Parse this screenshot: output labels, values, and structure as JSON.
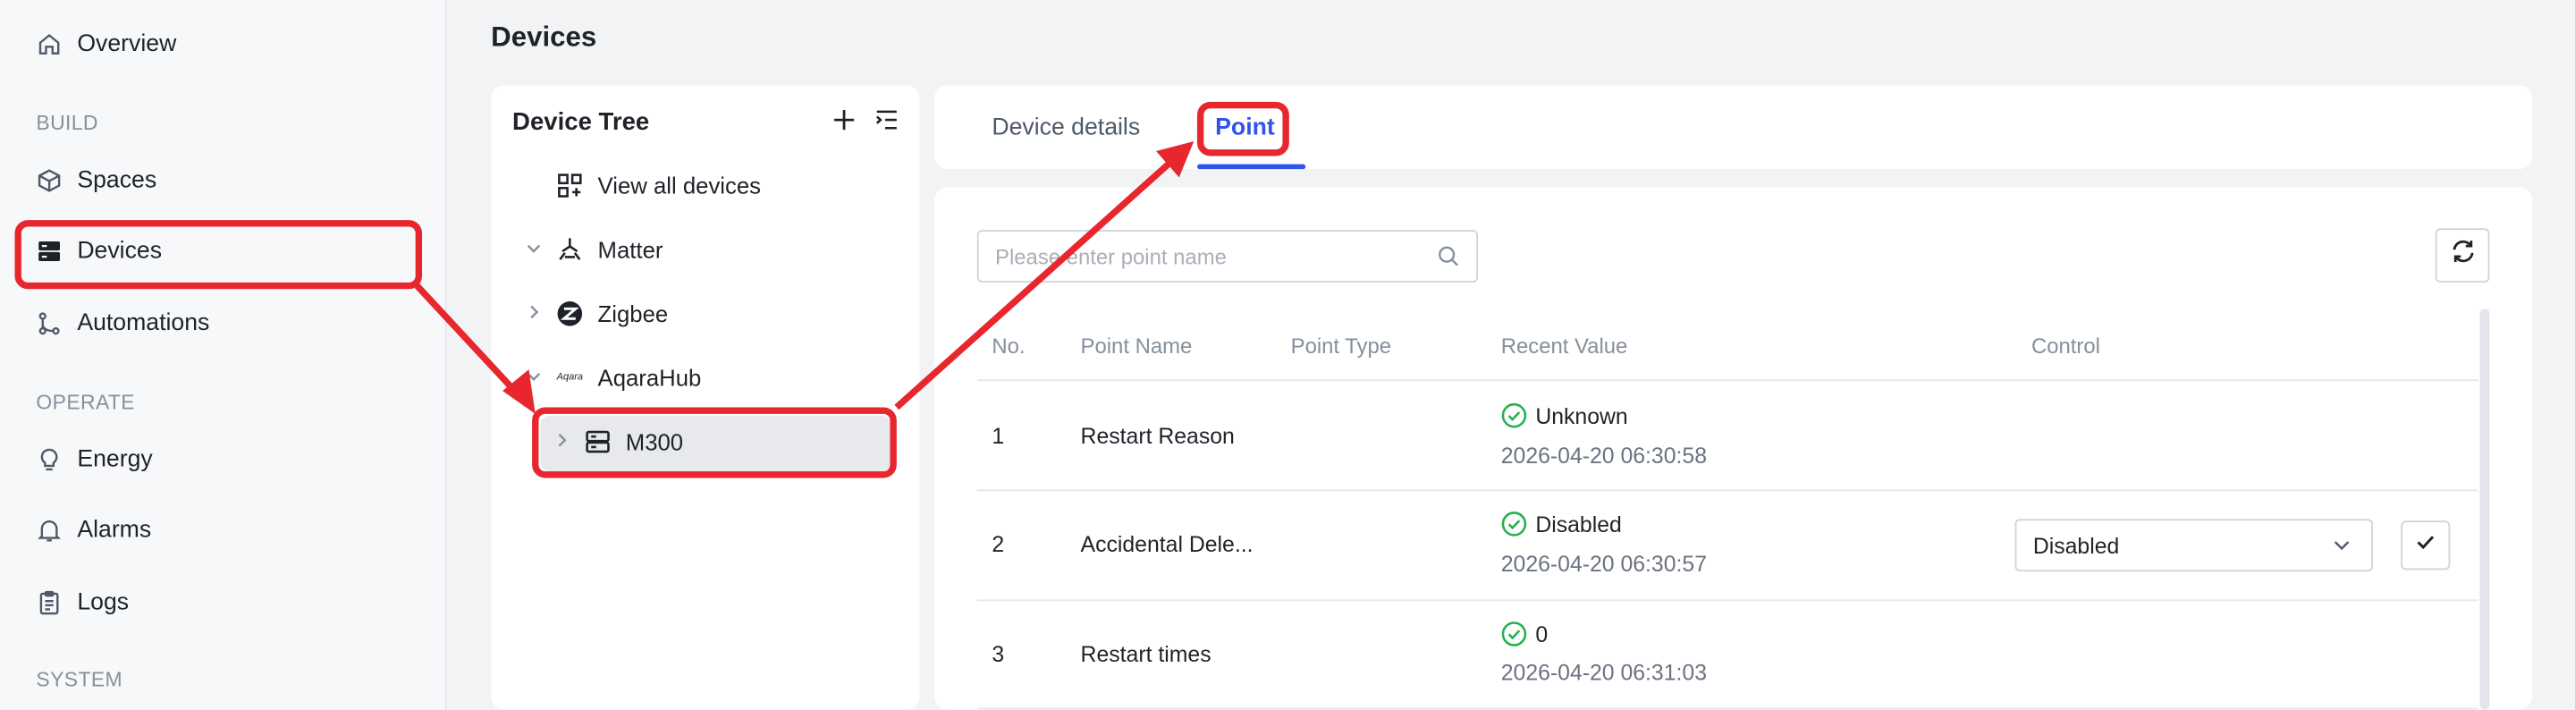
{
  "sidebar": {
    "overview": "Overview",
    "section_build": "BUILD",
    "spaces": "Spaces",
    "devices": "Devices",
    "automations": "Automations",
    "section_operate": "OPERATE",
    "energy": "Energy",
    "alarms": "Alarms",
    "logs": "Logs",
    "section_system": "SYSTEM"
  },
  "page_title": "Devices",
  "tree": {
    "title": "Device Tree",
    "view_all": "View all devices",
    "nodes": [
      "Matter",
      "Zigbee",
      "AqaraHub",
      "M300"
    ],
    "aqara_logo_text": "Aqara"
  },
  "tabs": [
    "Device details",
    "Point"
  ],
  "search": {
    "placeholder": "Please enter point name",
    "value": ""
  },
  "table": {
    "headers": [
      "No.",
      "Point Name",
      "Point Type",
      "Recent Value",
      "Control"
    ],
    "rows": [
      {
        "no": "1",
        "name": "Restart Reason",
        "type": "",
        "value": "Unknown",
        "time": "2026-04-20 06:30:58"
      },
      {
        "no": "2",
        "name": "Accidental Dele...",
        "type": "",
        "value": "Disabled",
        "time": "2026-04-20 06:30:57",
        "control_value": "Disabled"
      },
      {
        "no": "3",
        "name": "Restart times",
        "type": "",
        "value": "0",
        "time": "2026-04-20 06:31:03"
      }
    ]
  },
  "colors": {
    "accent": "#2f54eb",
    "status_ok": "#23b14d",
    "annotation": "#e8262d"
  },
  "icons": [
    "home-icon",
    "cube-icon",
    "server-icon",
    "branch-icon",
    "bulb-icon",
    "bell-icon",
    "clipboard-icon",
    "plus-icon",
    "collapse-list-icon",
    "grid-icon",
    "matter-icon",
    "zigbee-icon",
    "search-icon",
    "refresh-icon",
    "check-circle-icon",
    "chevron-down-icon",
    "check-icon"
  ]
}
